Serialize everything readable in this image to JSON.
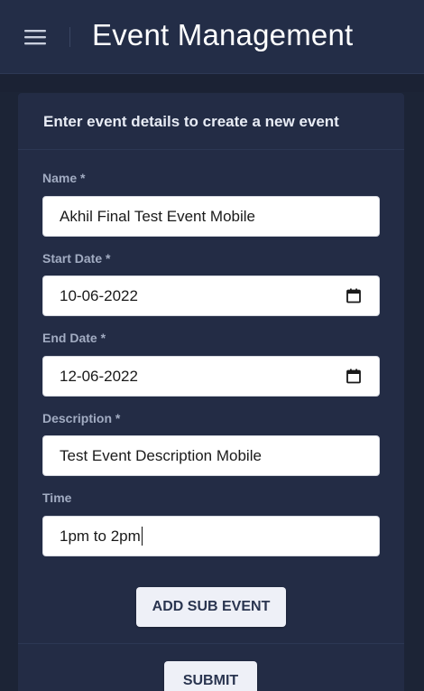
{
  "app": {
    "title": "Event Management"
  },
  "icons": {
    "menu": "hamburger-menu-icon",
    "calendar": "calendar-icon"
  },
  "colors": {
    "app_bar": "#232d47",
    "background": "#1c2436",
    "card": "#232c45",
    "label": "#a2acc2",
    "button_bg": "#eef0f7",
    "button_text": "#2a3550"
  },
  "form": {
    "header": "Enter event details to create a new event",
    "fields": {
      "name": {
        "label": "Name *",
        "value": "Akhil Final Test Event Mobile"
      },
      "start_date": {
        "label": "Start Date *",
        "value": "10-06-2022"
      },
      "end_date": {
        "label": "End Date *",
        "value": "12-06-2022"
      },
      "description": {
        "label": "Description *",
        "value": "Test Event Description Mobile"
      },
      "time": {
        "label": "Time",
        "value": "1pm to 2pm"
      }
    },
    "add_sub_event_label": "ADD SUB EVENT",
    "submit_label": "SUBMIT"
  }
}
